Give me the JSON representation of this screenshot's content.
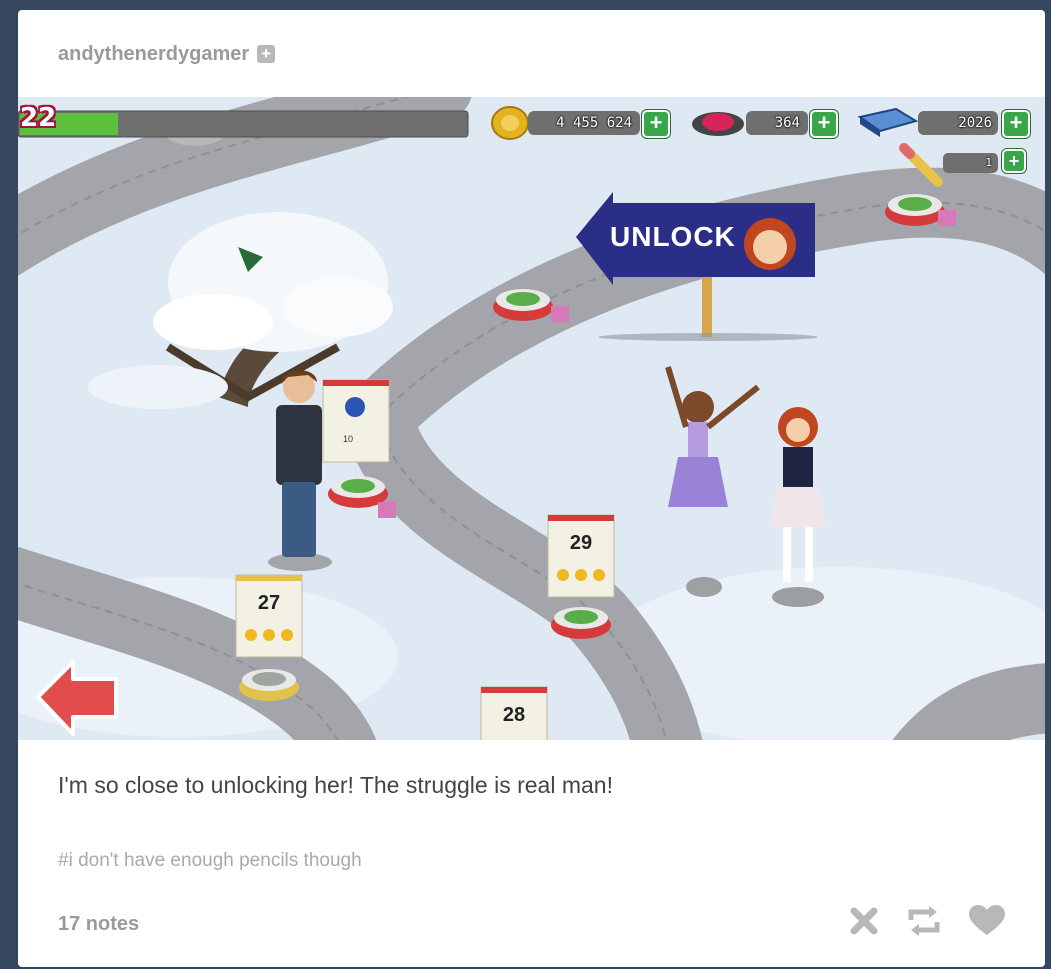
{
  "post": {
    "username": "andythenerdygamer",
    "caption": "I'm so close to unlocking her! The struggle is real man!",
    "tags": "#i don't have enough pencils though",
    "notes": "17 notes"
  },
  "game": {
    "level": "22",
    "xp_fraction": 0.22,
    "coins": "4 455 624",
    "gems": "364",
    "books": "2026",
    "pencils": "1",
    "unlock_sign": "UNLOCK",
    "pencil_cost": "10",
    "levels": [
      "27",
      "28",
      "29"
    ],
    "colors": {
      "sign": "#2b2e86",
      "button_green": "#3aa64a",
      "path": "#a3a5aa",
      "snow": "#dfe9f3",
      "arrow_red": "#e34c4c"
    }
  },
  "icons": {
    "follow": "plus-square-icon",
    "coin": "coin-icon",
    "gem": "gem-icon",
    "book": "book-icon",
    "pencil": "pencil-icon",
    "back": "back-arrow-icon",
    "dismiss": "close-icon",
    "reblog": "reblog-icon",
    "like": "heart-icon"
  }
}
